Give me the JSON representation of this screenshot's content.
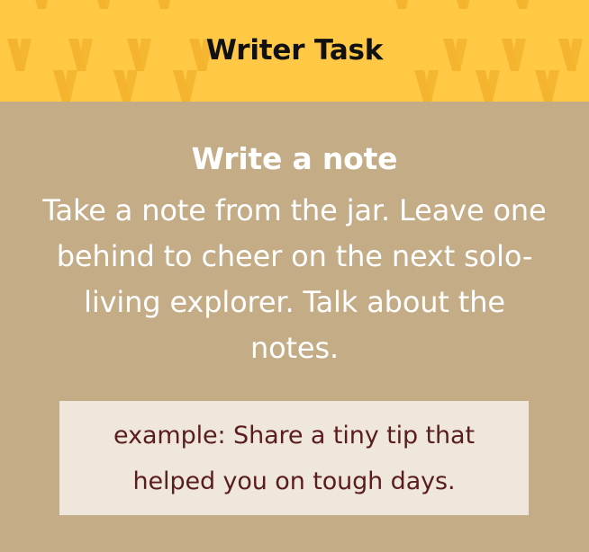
{
  "header": {
    "title": "Writer Task"
  },
  "task": {
    "title": "Write a note",
    "description": "Take a note from the jar. Leave one behind to cheer on the next solo-living explorer. Talk about the notes."
  },
  "example": {
    "text": "example: Share a tiny tip that helped you on tough days."
  },
  "colors": {
    "header_background": "#ffc845",
    "header_pattern": "#f4b42f",
    "body_background": "#c4ac87",
    "example_background": "#efe6dc",
    "example_text": "#5a1d1d",
    "title_text": "#111111",
    "body_text": "#ffffff"
  }
}
